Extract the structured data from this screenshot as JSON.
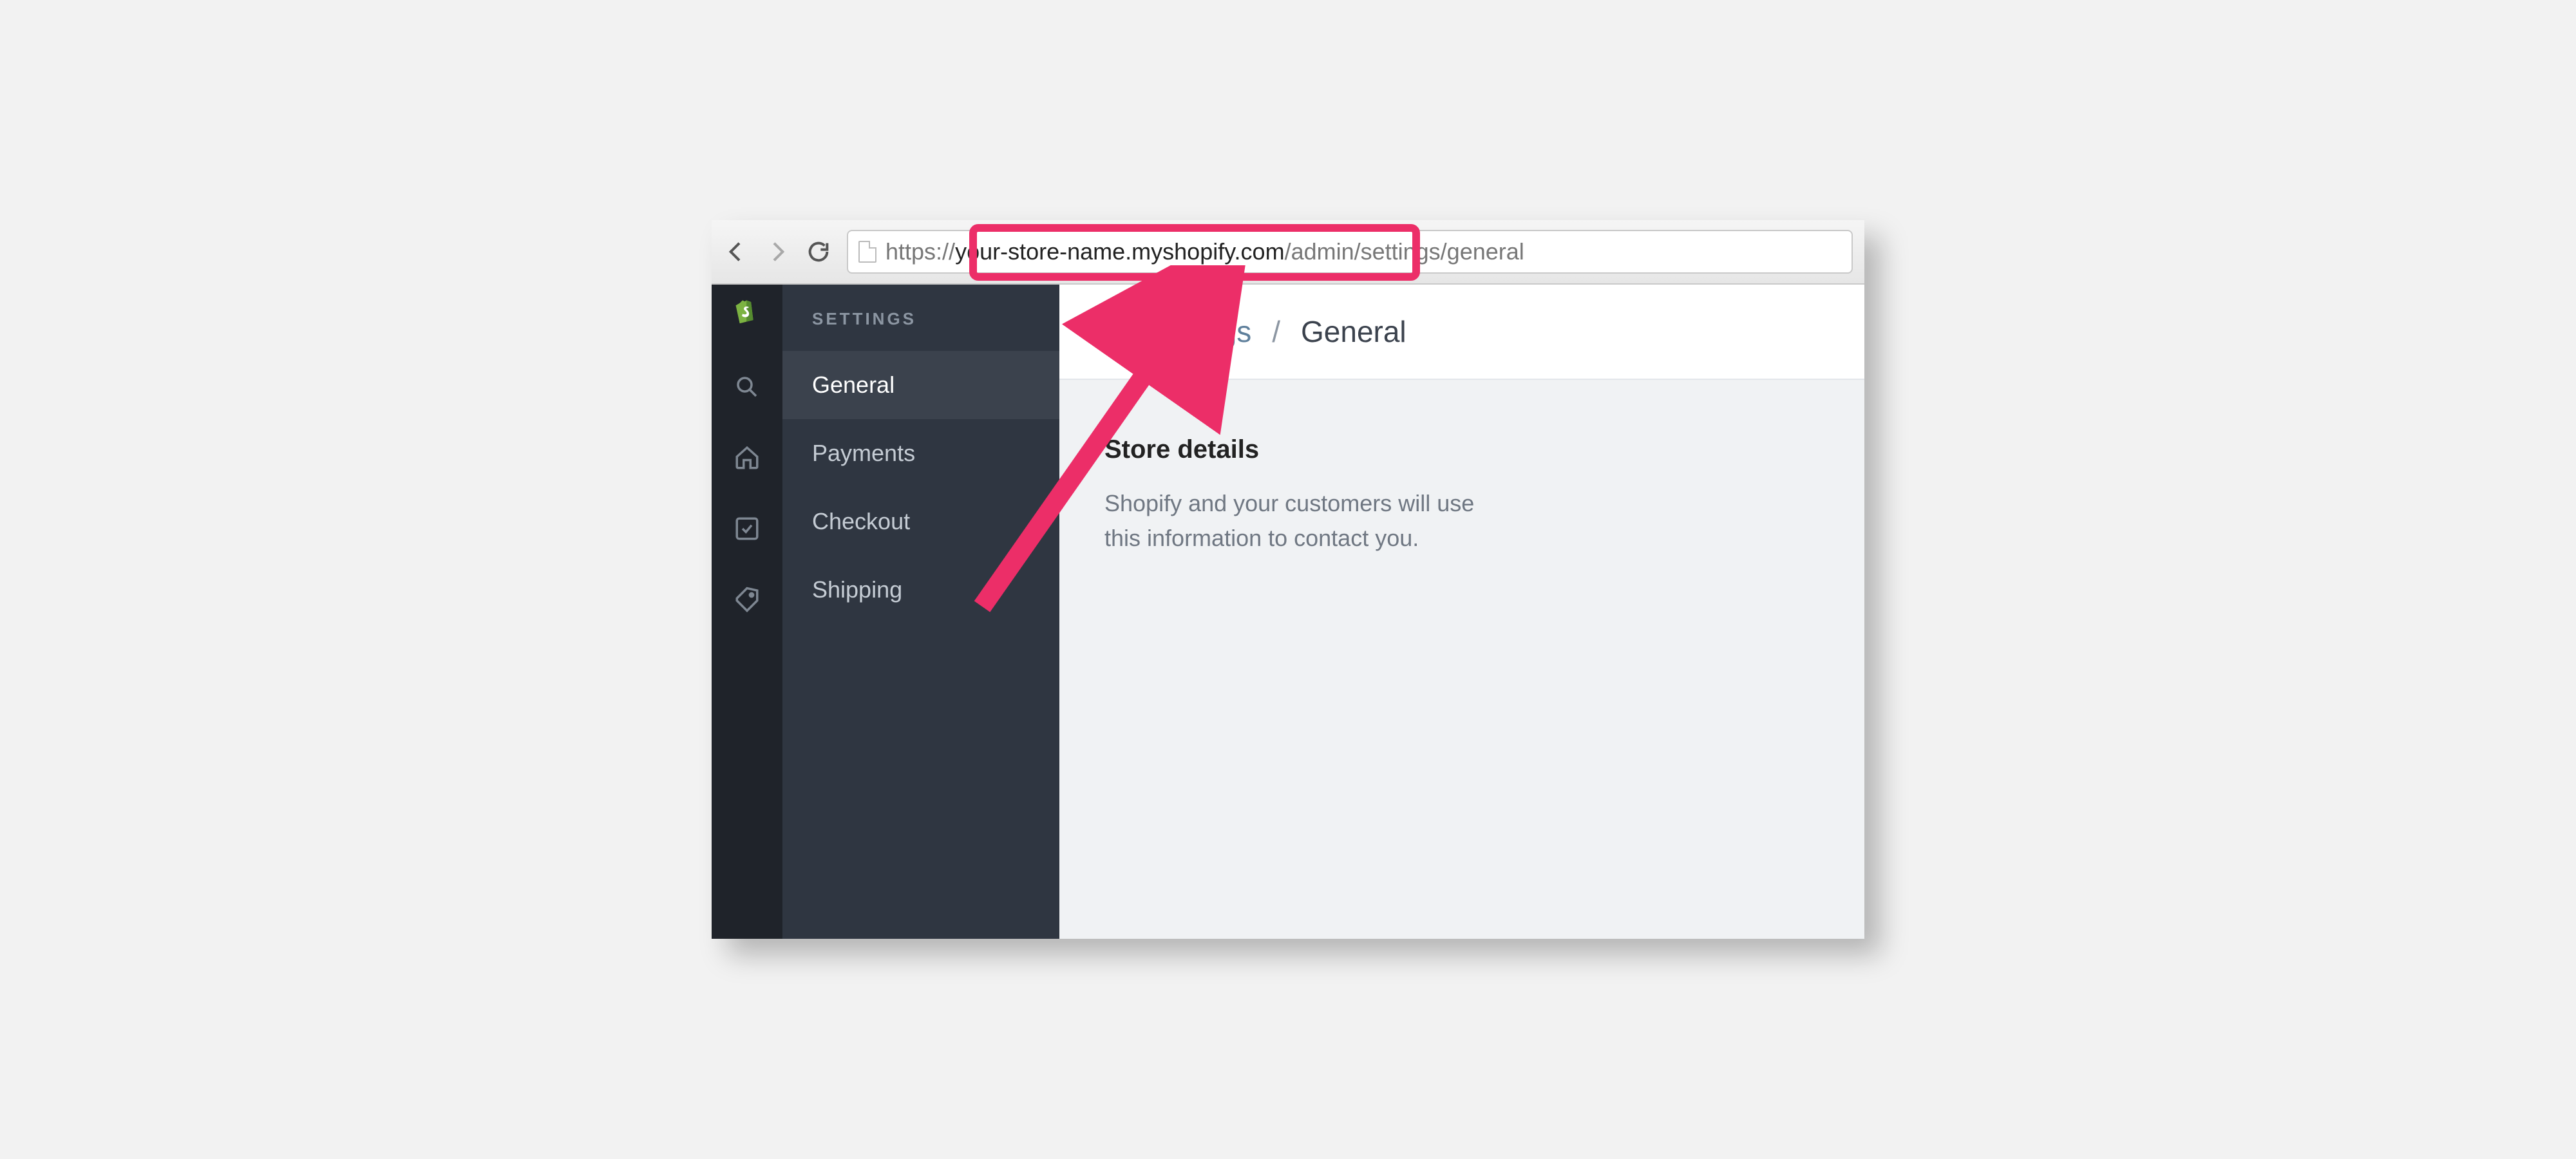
{
  "browser": {
    "url_prefix": "https://",
    "url_domain": "your-store-name.myshopify.com",
    "url_suffix": "/admin/settings/general"
  },
  "rail": {
    "icons": [
      "shopify-logo",
      "search-icon",
      "home-icon",
      "checkbox-icon",
      "tag-icon"
    ]
  },
  "sidebar": {
    "title": "SETTINGS",
    "items": [
      {
        "label": "General",
        "active": true
      },
      {
        "label": "Payments",
        "active": false
      },
      {
        "label": "Checkout",
        "active": false
      },
      {
        "label": "Shipping",
        "active": false
      }
    ]
  },
  "main": {
    "breadcrumb_link": "Settings",
    "breadcrumb_sep": "/",
    "breadcrumb_current": "General",
    "section_title": "Store details",
    "section_desc": "Shopify and your customers will use this information to contact you."
  },
  "colors": {
    "callout": "#ec2e68"
  }
}
